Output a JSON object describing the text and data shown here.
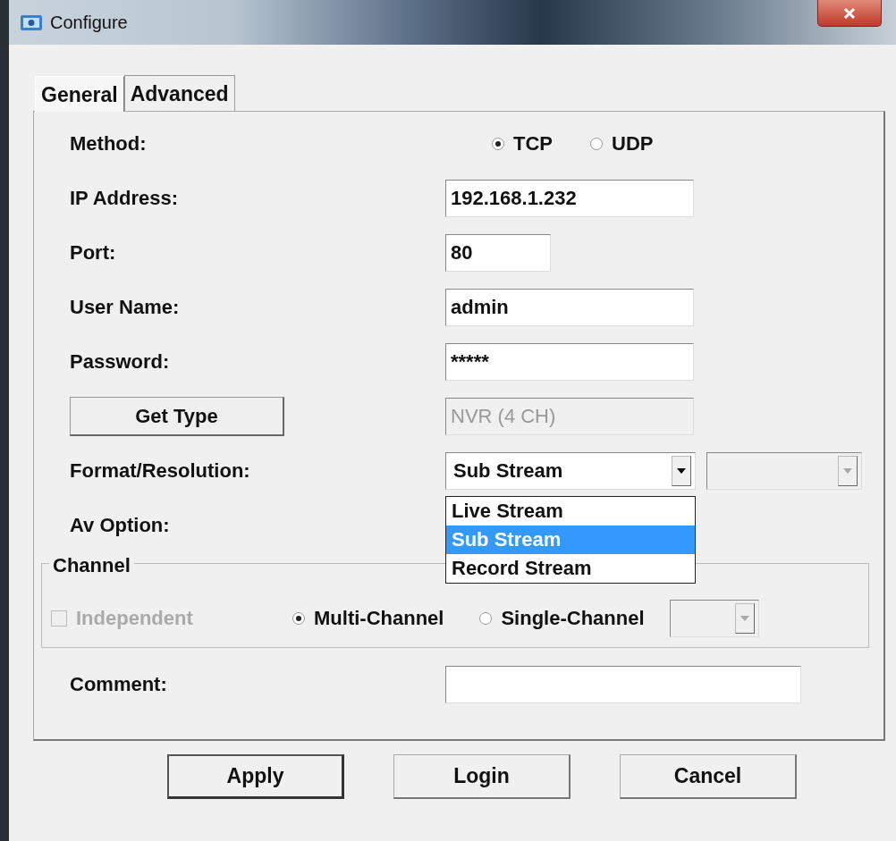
{
  "window": {
    "title": "Configure"
  },
  "tabs": [
    {
      "label": "General",
      "selected": true
    },
    {
      "label": "Advanced",
      "selected": false
    }
  ],
  "rows": [
    {
      "kind": "radios",
      "label": "Method:",
      "options": [
        {
          "label": "TCP",
          "selected": true
        },
        {
          "label": "UDP",
          "selected": false
        }
      ]
    },
    {
      "kind": "text",
      "label": "IP Address:",
      "value": "192.168.1.232"
    },
    {
      "kind": "short_text",
      "label": "Port:",
      "value": "80"
    },
    {
      "kind": "text",
      "label": "User Name:",
      "value": "admin"
    },
    {
      "kind": "text",
      "label": "Password:",
      "value": "*****"
    },
    {
      "kind": "button",
      "label": "Get Type",
      "value": "NVR (4 CH)",
      "disabled": true
    },
    {
      "kind": "select",
      "label": "Format/Resolution:",
      "value": "Sub Stream",
      "open": true,
      "options": [
        {
          "label": "Live Stream",
          "selected": false
        },
        {
          "label": "Sub Stream",
          "selected": true
        },
        {
          "label": "Record Stream",
          "selected": false
        }
      ]
    },
    {
      "kind": "label",
      "label": "Av Option:"
    }
  ],
  "channel": {
    "legend": "Channel",
    "independent": {
      "label": "Independent",
      "checked": false,
      "disabled": true
    },
    "modes": [
      {
        "label": "Multi-Channel",
        "selected": true
      },
      {
        "label": "Single-Channel",
        "selected": false
      }
    ]
  },
  "comment": {
    "label": "Comment:"
  },
  "buttons": [
    {
      "label": "Apply",
      "default": true
    },
    {
      "label": "Login",
      "default": false
    },
    {
      "label": "Cancel",
      "default": false
    }
  ]
}
